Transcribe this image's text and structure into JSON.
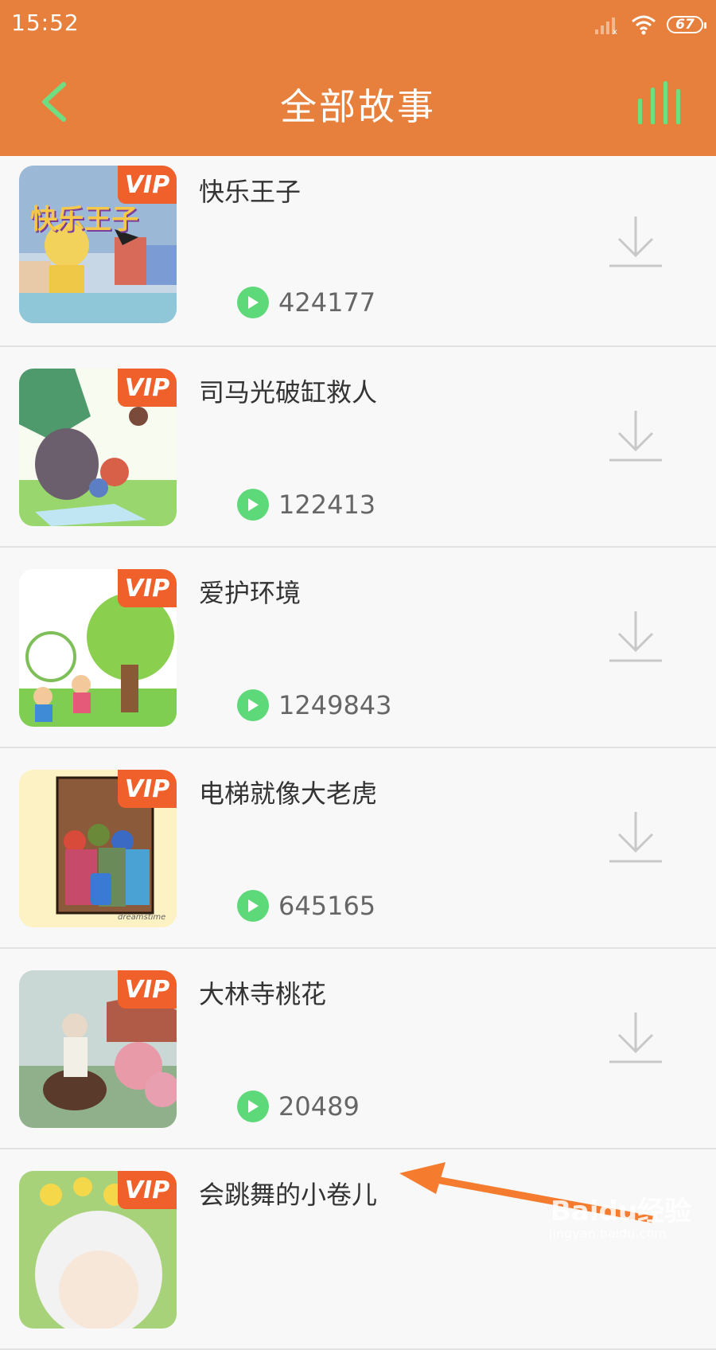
{
  "status_bar": {
    "time": "15:52",
    "battery": "67"
  },
  "header": {
    "title": "全部故事",
    "back_icon": "chevron-left-icon",
    "menu_icon": "bars-icon",
    "accent": "#e8803d",
    "icon_color": "#6fdd82"
  },
  "badge_label": "VIP",
  "stories": [
    {
      "title": "快乐王子",
      "plays": "424177",
      "cover_text": "快乐王子"
    },
    {
      "title": "司马光破缸救人",
      "plays": "122413"
    },
    {
      "title": "爱护环境",
      "plays": "1249843"
    },
    {
      "title": "电梯就像大老虎",
      "plays": "645165",
      "cover_text": "dreamstime"
    },
    {
      "title": "大林寺桃花",
      "plays": "20489"
    },
    {
      "title": "会跳舞的小卷儿",
      "plays": ""
    }
  ],
  "watermark": {
    "brand": "Baidu经验",
    "url": "jingyan.baidu.com"
  }
}
